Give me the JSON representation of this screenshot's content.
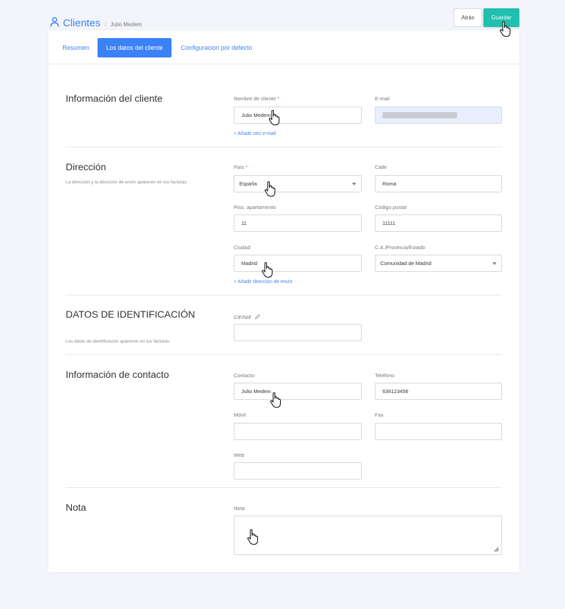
{
  "header": {
    "title": "Clientes",
    "separator": "/",
    "subtitle": "Julio Medem",
    "back_label": "Atrás",
    "save_label": "Guardar"
  },
  "tabs": [
    {
      "label": "Resumen",
      "active": false
    },
    {
      "label": "Los datos del cliente",
      "active": true
    },
    {
      "label": "Configuracion por defecto",
      "active": false
    }
  ],
  "sections": {
    "client_info": {
      "title": "Información del cliente",
      "name_label": "Nombre de cliente",
      "name_value": "Julio Medem",
      "email_label": "E-mail",
      "add_email": "+ Añadir otro e-mail"
    },
    "address": {
      "title": "Dirección",
      "desc": "La dirección y la dirección de envío aparecen en tus facturas",
      "country_label": "País",
      "country_value": "España",
      "street_label": "Calle",
      "street_value": "Roma",
      "floor_label": "Piso, apartamento",
      "floor_value": "11",
      "postal_label": "Código postal",
      "postal_value": "11111",
      "city_label": "Ciudad",
      "city_value": "Madrid",
      "province_label": "C.A./Provincia/Estado",
      "province_value": "Comunidad de Madrid",
      "add_shipping": "+ Añadir dirección de envío"
    },
    "identification": {
      "title": "DATOS DE IDENTIFICACIÓN",
      "desc": "Los datos de identificación aparecen en tus facturas",
      "cif_label": "CIF/NIF",
      "cif_value": ""
    },
    "contact": {
      "title": "Información de contacto",
      "contact_label": "Contacto",
      "contact_value": "Julio Medem",
      "phone_label": "Teléfono",
      "phone_value": "636123456",
      "mobile_label": "Móvil",
      "mobile_value": "",
      "fax_label": "Fax",
      "fax_value": "",
      "web_label": "Web",
      "web_value": ""
    },
    "note": {
      "title": "Nota",
      "note_label": "Nota"
    }
  },
  "required_marker": "*",
  "colors": {
    "accent": "#3b82f6",
    "save": "#21bfad",
    "background": "#f3f5fa",
    "required": "#e05a5a"
  }
}
